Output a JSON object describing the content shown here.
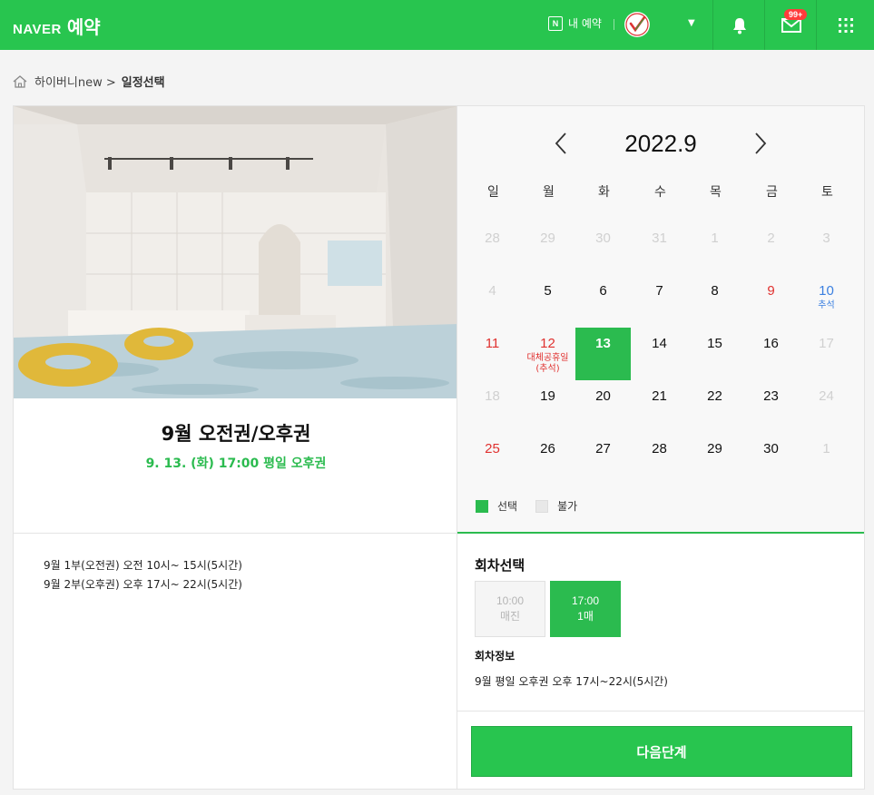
{
  "header": {
    "brand": "NAVER",
    "service": "예약",
    "my_reservation_icon_letter": "N",
    "my_reservation": "내 예약",
    "mail_badge": "99+",
    "icons": [
      "bell-icon",
      "mail-icon",
      "apps-grid-icon"
    ],
    "accent": "#28c54f"
  },
  "breadcrumb": {
    "shop": "하이버니new >",
    "current": "일정선택"
  },
  "product": {
    "title": "9월 오전권/오후권",
    "selected_summary": "9. 13. (화) 17:00 평일 오후권",
    "description": [
      "9월 1부(오전권) 오전 10시~ 15시(5시간)",
      "9월 2부(오후권) 오후 17시~ 22시(5시간)"
    ]
  },
  "calendar": {
    "month_label": "2022.9",
    "weekdays": [
      "일",
      "월",
      "화",
      "수",
      "목",
      "금",
      "토"
    ],
    "weeks": [
      [
        {
          "d": "28",
          "s": "dim"
        },
        {
          "d": "29",
          "s": "dim"
        },
        {
          "d": "30",
          "s": "dim"
        },
        {
          "d": "31",
          "s": "dim"
        },
        {
          "d": "1",
          "s": "dim"
        },
        {
          "d": "2",
          "s": "dim"
        },
        {
          "d": "3",
          "s": "dim"
        }
      ],
      [
        {
          "d": "4",
          "s": "dim"
        },
        {
          "d": "5",
          "s": ""
        },
        {
          "d": "6",
          "s": ""
        },
        {
          "d": "7",
          "s": ""
        },
        {
          "d": "8",
          "s": ""
        },
        {
          "d": "9",
          "s": "red"
        },
        {
          "d": "10",
          "s": "blue",
          "note": "추석"
        }
      ],
      [
        {
          "d": "11",
          "s": "red"
        },
        {
          "d": "12",
          "s": "red",
          "note": "대체공휴일\n(추석)"
        },
        {
          "d": "13",
          "s": "sel"
        },
        {
          "d": "14",
          "s": ""
        },
        {
          "d": "15",
          "s": ""
        },
        {
          "d": "16",
          "s": ""
        },
        {
          "d": "17",
          "s": "dim"
        }
      ],
      [
        {
          "d": "18",
          "s": "dim"
        },
        {
          "d": "19",
          "s": ""
        },
        {
          "d": "20",
          "s": ""
        },
        {
          "d": "21",
          "s": ""
        },
        {
          "d": "22",
          "s": ""
        },
        {
          "d": "23",
          "s": ""
        },
        {
          "d": "24",
          "s": "dim"
        }
      ],
      [
        {
          "d": "25",
          "s": "red"
        },
        {
          "d": "26",
          "s": ""
        },
        {
          "d": "27",
          "s": ""
        },
        {
          "d": "28",
          "s": ""
        },
        {
          "d": "29",
          "s": ""
        },
        {
          "d": "30",
          "s": ""
        },
        {
          "d": "1",
          "s": "dim"
        }
      ]
    ],
    "legend_selected": "선택",
    "legend_unavailable": "불가"
  },
  "rounds": {
    "title": "회차선택",
    "slots": [
      {
        "time": "10:00",
        "status": "매진"
      },
      {
        "time": "17:00",
        "status": "1매"
      }
    ],
    "info_title": "회차정보",
    "info_text": "9월 평일 오후권 오후 17시~22시(5시간)"
  },
  "next_button": "다음단계"
}
